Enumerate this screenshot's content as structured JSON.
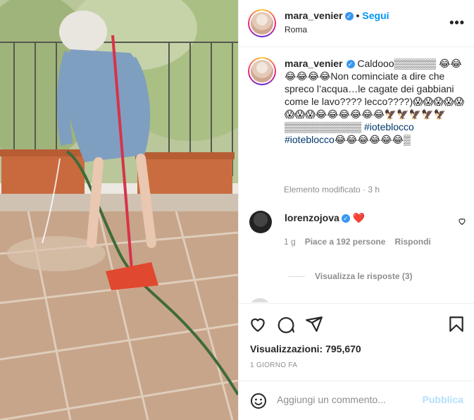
{
  "header": {
    "username": "mara_venier",
    "follow_label": "Segui",
    "location": "Roma",
    "dot": "•",
    "more": "•••"
  },
  "caption": {
    "username": "mara_venier",
    "text_part1": " Caldooo▒▒▒▒▒▒ 😂😂😂😂😂😂Non cominciate a dire che spreco l’acqua…le cagate dei gabbiani come le lavo???? lecco????)😱😱😱😱😱😱😱😱😂😂😂😂😂😂🦅🦅🦅🦅🦅▒▒▒▒▒▒▒▒▒▒▒ ",
    "hashtag1": "#ioteblocco",
    "hashtag2": "#ioteblocco",
    "text_part2": "😂😂😂😂😂😂▒",
    "edited": "Elemento modificato · 3 h"
  },
  "comment": {
    "username": "lorenzojova",
    "text": " ❤️",
    "time": "1 g",
    "likes": "Piace a 192 persone",
    "reply_label": "Rispondi",
    "view_replies": "Visualizza le risposte (3)"
  },
  "actions": {
    "icons": [
      "heart-icon",
      "comment-icon",
      "share-icon",
      "bookmark-icon"
    ],
    "views_label": "Visualizzazioni:",
    "views_count": "795,670",
    "date": "1 GIORNO FA"
  },
  "add_comment": {
    "placeholder": "Aggiungi un commento...",
    "post_label": "Pubblica"
  },
  "colors": {
    "accent": "#0095f6",
    "post_disabled": "#b2dffc",
    "heart_red": "#ed4956",
    "muted": "#8e8e8e"
  }
}
